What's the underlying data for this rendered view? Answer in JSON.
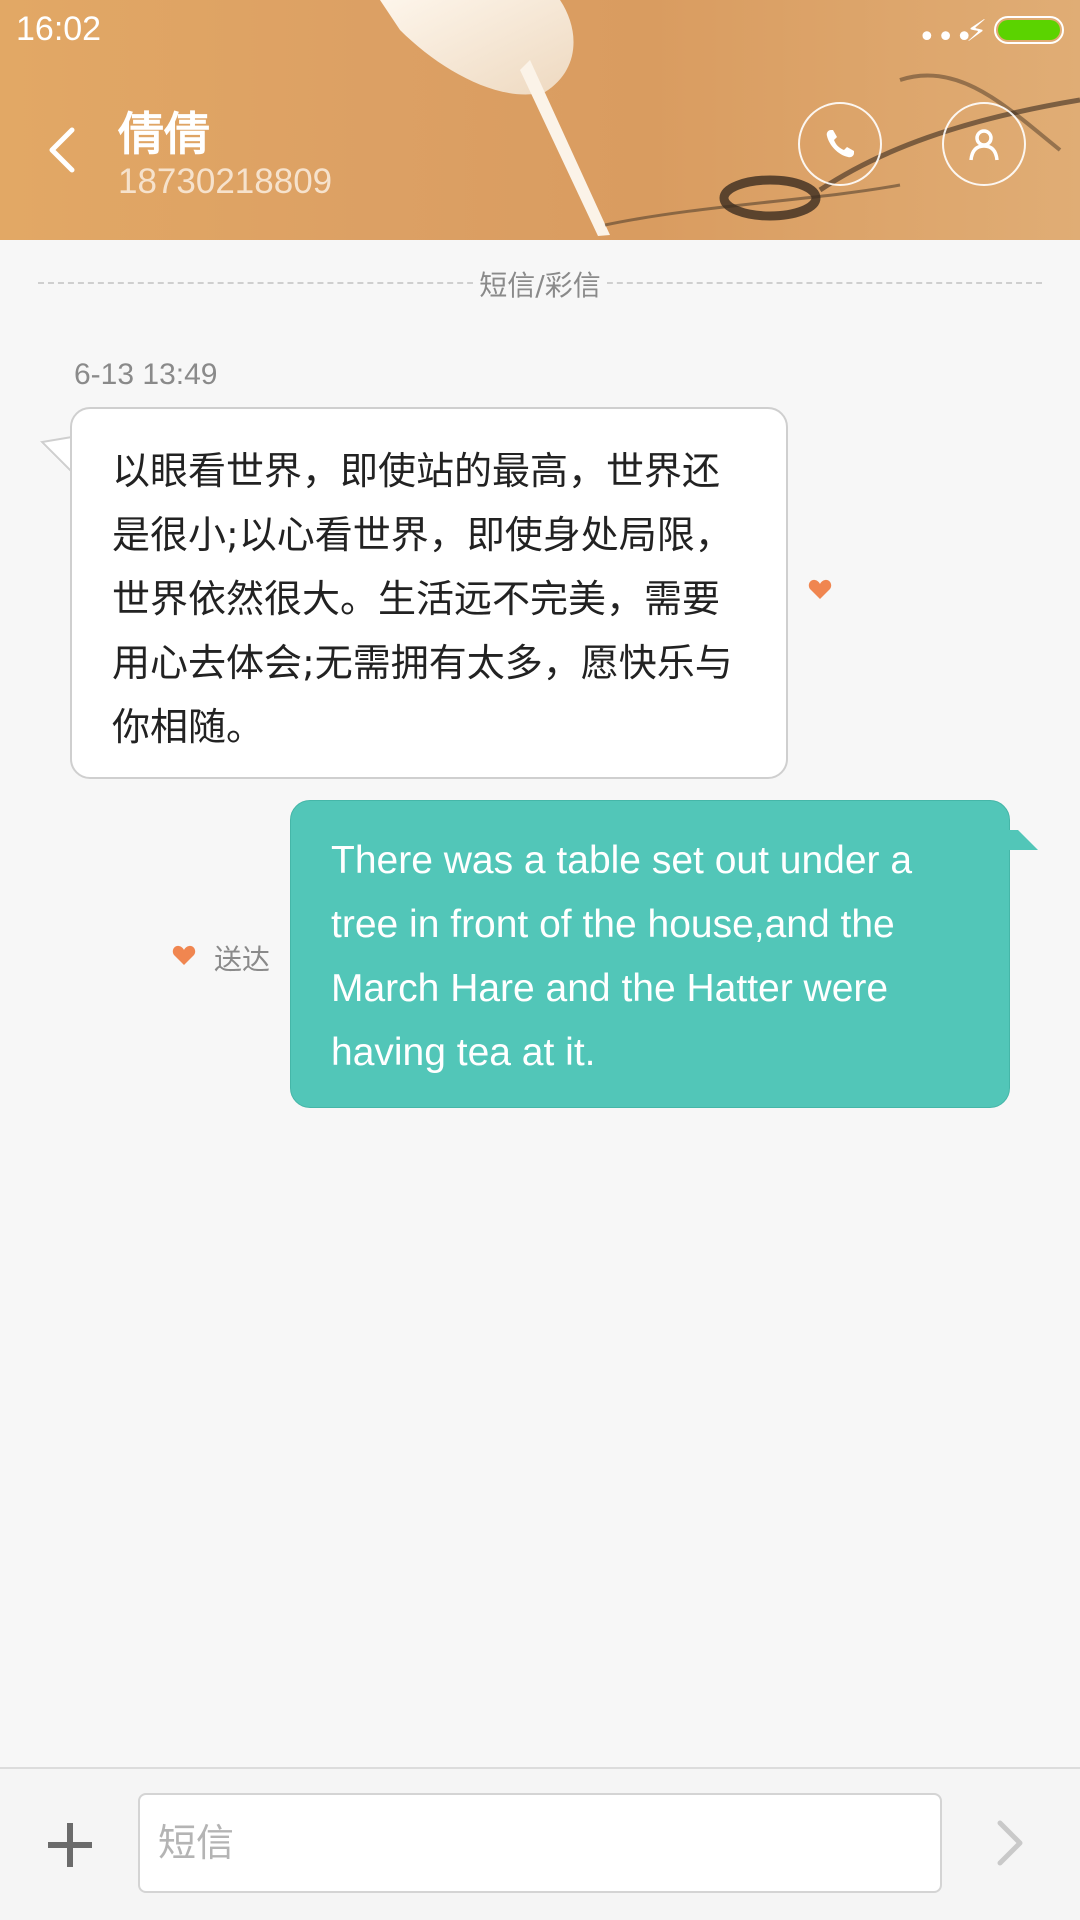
{
  "status_bar": {
    "time": "16:02",
    "dots": "•••",
    "battery_color": "#5bd300"
  },
  "header": {
    "contact_name": "倩倩",
    "contact_number": "18730218809",
    "back_icon": "chevron-left-icon",
    "call_icon": "phone-icon",
    "profile_icon": "person-icon"
  },
  "conversation": {
    "divider_label": "短信/彩信",
    "timestamp": "6-13 13:49",
    "messages": [
      {
        "direction": "incoming",
        "text": "以眼看世界，即使站的最高，世界还是很小;以心看世界，即使身处局限，世界依然很大。生活远不完美，需要用心去体会;无需拥有太多，愿快乐与你相随。",
        "favorite_icon": "heart-icon"
      },
      {
        "direction": "outgoing",
        "text": "There was a table set out under a tree in front of the house,and the March Hare and the Hatter were having tea at it.",
        "status": "送达",
        "favorite_icon": "heart-icon"
      }
    ]
  },
  "composer": {
    "placeholder": "短信",
    "value": "",
    "add_icon": "plus-icon",
    "send_icon": "chevron-right-icon"
  },
  "colors": {
    "outgoing_bubble": "#52c6b8",
    "incoming_bubble": "#ffffff",
    "heart": "#f08650",
    "header": "#dca064"
  }
}
